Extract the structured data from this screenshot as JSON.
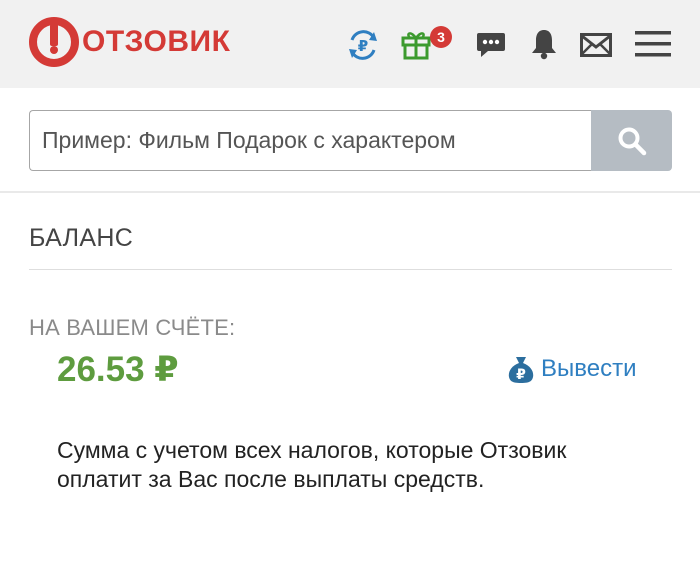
{
  "header": {
    "logo_text": "ОТЗОВИК",
    "brand_color": "#d43a36",
    "icons": [
      "ruble-exchange-icon",
      "gift-icon",
      "chat-icon",
      "bell-icon",
      "mail-icon",
      "menu-icon"
    ],
    "gift_badge": "3"
  },
  "search": {
    "placeholder": "Пример: Фильм Подарок с характером",
    "value": ""
  },
  "balance": {
    "section_title": "БАЛАНС",
    "account_label": "НА ВАШЕМ СЧЁТЕ:",
    "amount": "26.53 ₽",
    "amount_color": "#5e9c3f",
    "withdraw_label": "Вывести",
    "note": "Сумма с учетом всех налогов, которые Отзовик оплатит за Вас после выплаты средств."
  }
}
